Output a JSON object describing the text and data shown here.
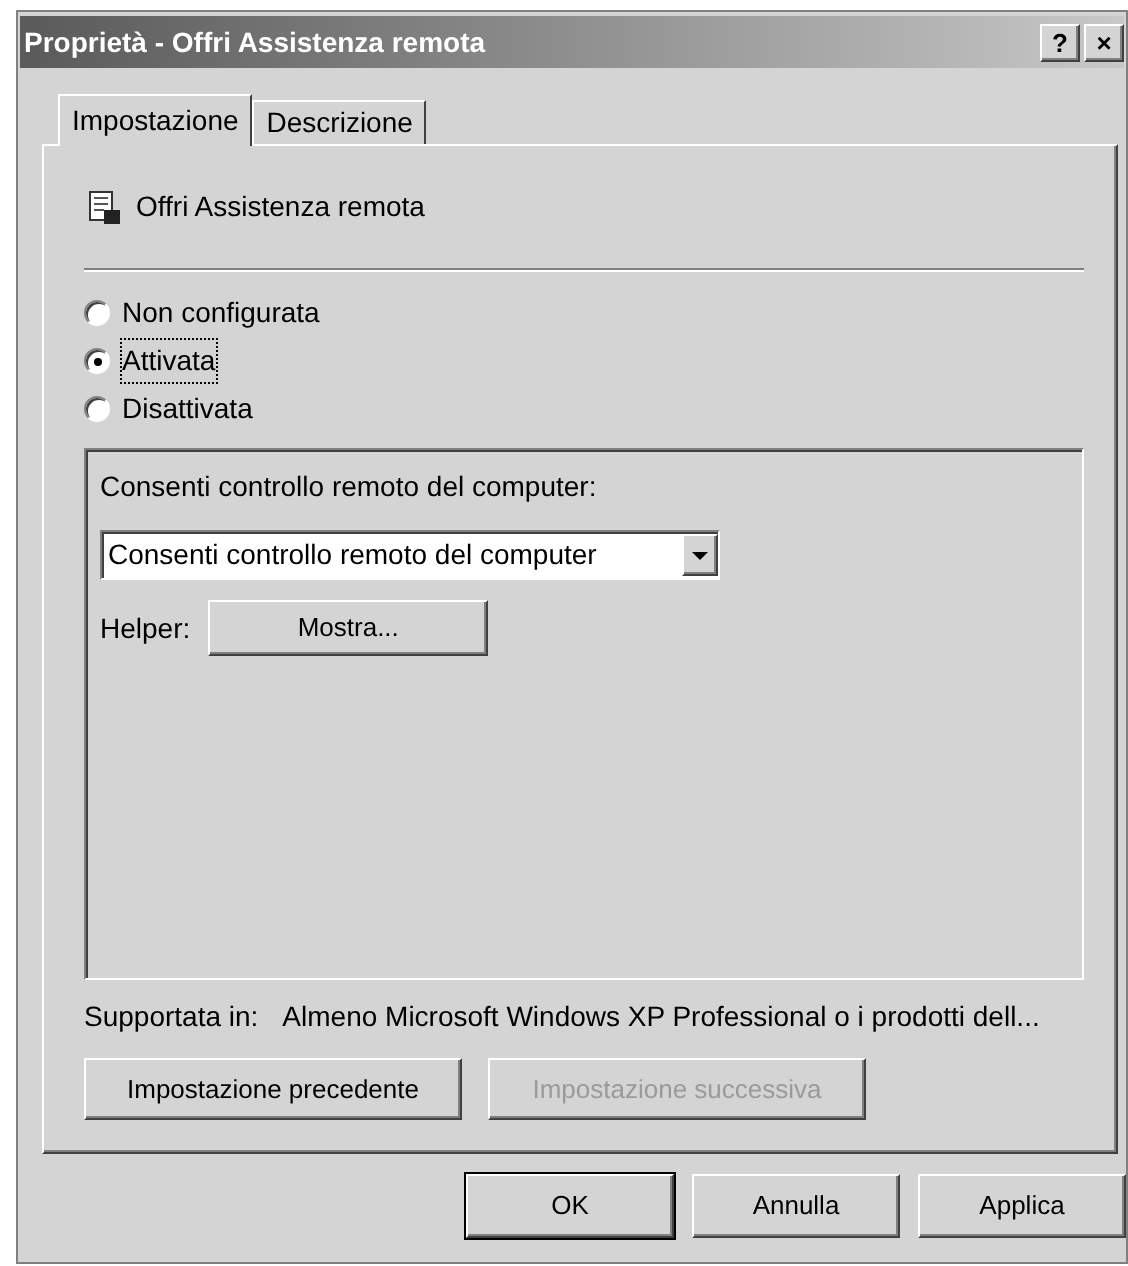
{
  "window": {
    "title": "Proprietà - Offri Assistenza remota",
    "title_buttons": [
      "?",
      "×"
    ]
  },
  "tabs": [
    {
      "label": "Impostazione",
      "selected": true
    },
    {
      "label": "Descrizione",
      "selected": false
    }
  ],
  "policy": {
    "name": "Offri Assistenza remota"
  },
  "options": [
    {
      "label": "Non configurata",
      "selected": false
    },
    {
      "label": "Attivata",
      "selected": true
    },
    {
      "label": "Disattivata",
      "selected": false
    }
  ],
  "group": {
    "label": "Consenti controllo remoto del computer:",
    "combo_value": "Consenti controllo remoto del computer",
    "helper_label": "Helper:",
    "helper_button": "Mostra..."
  },
  "supported": {
    "label": "Supportata in:",
    "value": "Almeno Microsoft Windows XP Professional o i prodotti dell..."
  },
  "nav_buttons": [
    {
      "label": "Impostazione precedente",
      "disabled": false
    },
    {
      "label": "Impostazione successiva",
      "disabled": true
    }
  ],
  "buttons": [
    {
      "label": "OK",
      "default": true
    },
    {
      "label": "Annulla",
      "default": false
    },
    {
      "label": "Applica",
      "default": false
    }
  ]
}
